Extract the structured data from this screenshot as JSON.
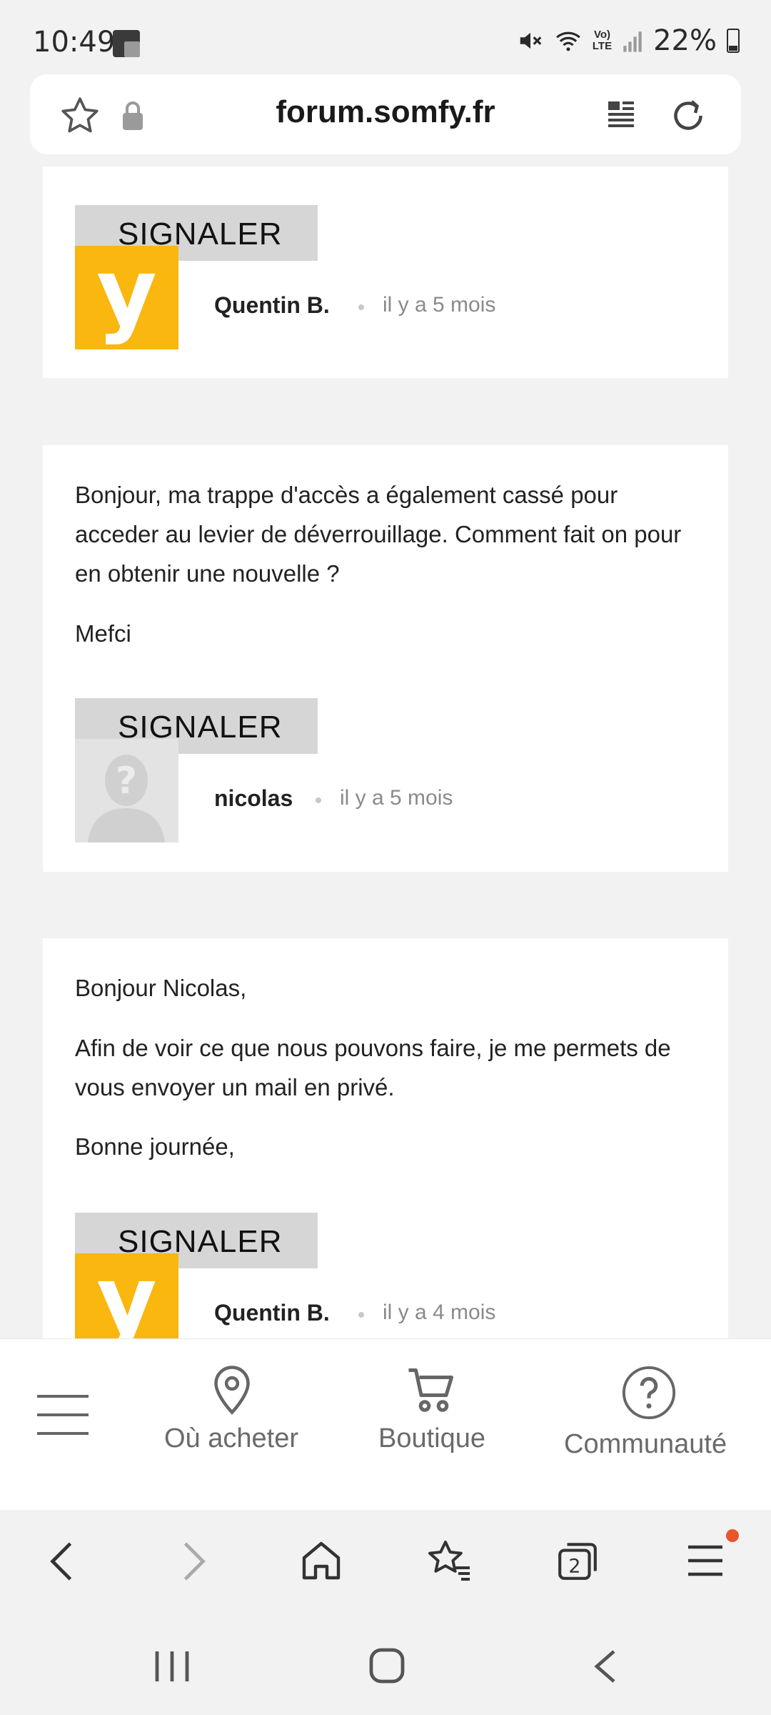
{
  "status_bar": {
    "time": "10:49",
    "battery": "22%",
    "network": "LTE"
  },
  "url_bar": {
    "url": "forum.somfy.fr"
  },
  "posts": [
    {
      "paragraphs": [],
      "report_label": "SIGNALER",
      "author": "Quentin B.",
      "time": "il y a 5 mois",
      "avatar_letter": "y"
    },
    {
      "paragraphs": [
        "Bonjour, ma trappe d'accès a également cassé pour acceder au levier de déverrouillage. Comment fait on pour en obtenir une nouvelle ?",
        "Mefci"
      ],
      "report_label": "SIGNALER",
      "author": "nicolas",
      "time": "il y a 5 mois",
      "avatar_letter": "?"
    },
    {
      "paragraphs": [
        "Bonjour Nicolas,",
        "Afin de voir ce que nous pouvons faire, je me permets de vous envoyer un mail en privé.",
        "Bonne journée,"
      ],
      "report_label": "SIGNALER",
      "author": "Quentin B.",
      "time": "il y a 4 mois",
      "avatar_letter": "y"
    }
  ],
  "site_nav": {
    "where_to_buy": "Où acheter",
    "shop": "Boutique",
    "community": "Communauté"
  },
  "colors": {
    "brand_yellow": "#f9b70f",
    "notification_dot": "#e8562a"
  }
}
